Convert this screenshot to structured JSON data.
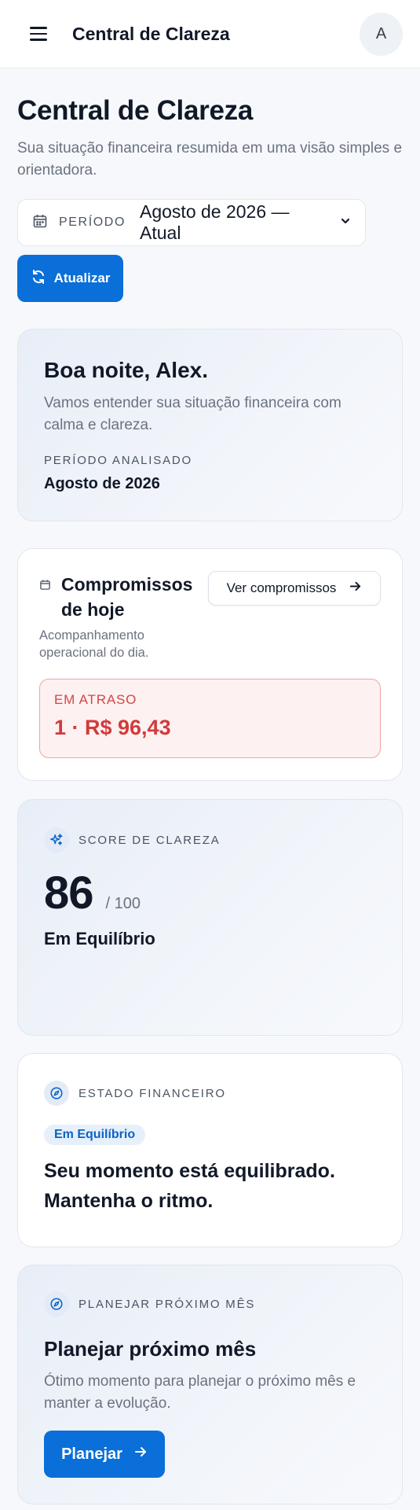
{
  "header": {
    "app_title": "Central de Clareza",
    "avatar_initial": "A"
  },
  "page": {
    "title": "Central de Clareza",
    "subtitle": "Sua situação financeira resumida em uma visão simples e orientadora."
  },
  "period": {
    "label": "PERÍODO",
    "value": "Agosto de 2026 — Atual"
  },
  "refresh_label": "Atualizar",
  "greeting": {
    "title": "Boa noite, Alex.",
    "subtitle": "Vamos entender sua situação financeira com calma e clareza.",
    "period_label": "PERÍODO ANALISADO",
    "period_value": "Agosto de 2026"
  },
  "commitments": {
    "title": "Compromissos de hoje",
    "subtitle": "Acompanhamento operacional do dia.",
    "button_label": "Ver compromissos",
    "overdue_label": "EM ATRASO",
    "overdue_value": "1 · R$ 96,43"
  },
  "score": {
    "label": "SCORE DE CLAREZA",
    "value": "86",
    "max": "/ 100",
    "status": "Em Equilíbrio"
  },
  "state": {
    "label": "ESTADO FINANCEIRO",
    "pill": "Em Equilíbrio",
    "message": "Seu momento está equilibrado. Mantenha o ritmo."
  },
  "plan": {
    "label": "PLANEJAR PRÓXIMO MÊS",
    "title": "Planejar próximo mês",
    "subtitle": "Ótimo momento para planejar o próximo mês e manter a evolução.",
    "button_label": "Planejar"
  },
  "colors": {
    "primary": "#0a6fd8",
    "danger": "#d13b3b",
    "danger_bg": "#fdf1f1"
  }
}
